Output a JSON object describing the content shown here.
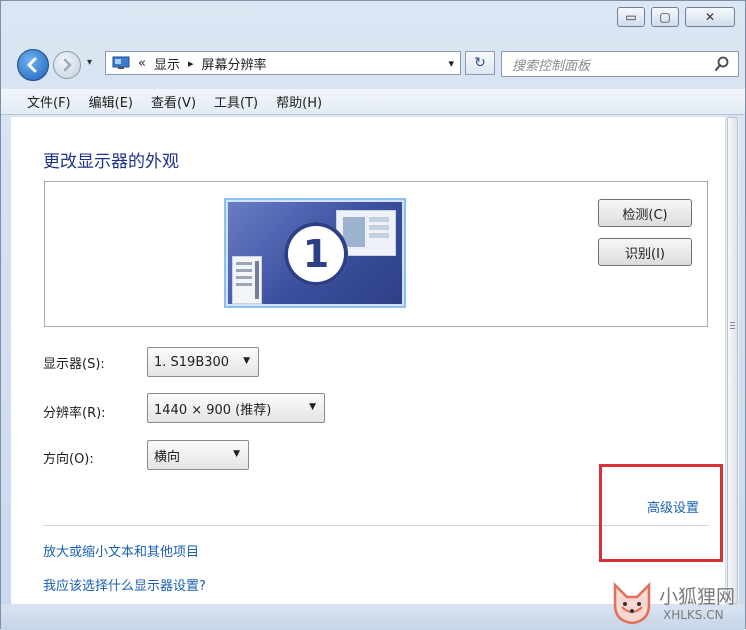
{
  "window": {
    "min_glyph": "▭",
    "max_glyph": "▢",
    "close_glyph": "✕"
  },
  "address": {
    "chevrons": "«",
    "crumb1": "显示",
    "separator": "▸",
    "crumb2": "屏幕分辨率",
    "dropdown_glyph": "▾",
    "refresh_glyph": "↻"
  },
  "search": {
    "placeholder": "搜索控制面板"
  },
  "menu": {
    "file": "文件(F)",
    "edit": "编辑(E)",
    "view": "查看(V)",
    "tools": "工具(T)",
    "help": "帮助(H)"
  },
  "page": {
    "title": "更改显示器的外观",
    "monitor_number": "1",
    "detect_button": "检测(C)",
    "identify_button": "识别(I)"
  },
  "settings": {
    "display_label": "显示器(S):",
    "display_value": "1. S19B300",
    "resolution_label": "分辨率(R):",
    "resolution_value": "1440 × 900 (推荐)",
    "orientation_label": "方向(O):",
    "orientation_value": "横向",
    "dropdown_arrow": "▼"
  },
  "links": {
    "advanced": "高级设置",
    "text_size": "放大或缩小文本和其他项目",
    "which_settings": "我应该选择什么显示器设置?"
  },
  "watermark": {
    "name": "小狐狸网",
    "domain": "XHLKS.CN"
  },
  "colors": {
    "highlight": "#d9313a",
    "link": "#1a5fb4",
    "title": "#1e3287"
  }
}
